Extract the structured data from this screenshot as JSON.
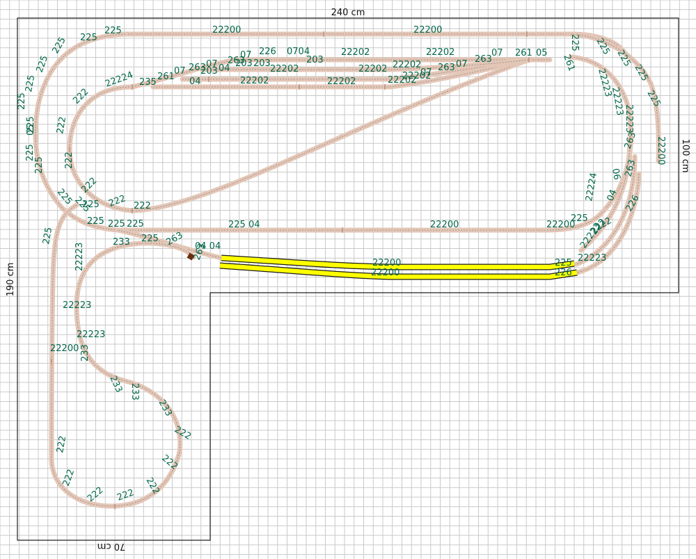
{
  "dimensions": {
    "width_top": "240 cm",
    "height_left": "190 cm",
    "height_right": "100 cm",
    "width_bottom": "70 cm"
  },
  "colors": {
    "track_bed": "#e4c6b6",
    "label": "#00674a",
    "selected_track": "#ffff00",
    "grid": "#c9c9c9"
  },
  "labels": [
    {
      "t": "225",
      "a": 0
    },
    {
      "t": "225",
      "a": 0
    },
    {
      "t": "22200",
      "a": 0
    },
    {
      "t": "22200",
      "a": 0
    },
    {
      "t": "225",
      "a": 0
    },
    {
      "t": "225",
      "a": 0
    },
    {
      "t": "225",
      "a": 0
    },
    {
      "t": "225",
      "a": 0
    },
    {
      "t": "225",
      "a": 0
    },
    {
      "t": "225",
      "a": 0
    },
    {
      "t": "22200",
      "a": 0
    },
    {
      "t": "225",
      "a": 0
    },
    {
      "t": "225",
      "a": 0
    },
    {
      "t": "225",
      "a": 0
    },
    {
      "t": "225",
      "a": 0
    },
    {
      "t": "225",
      "a": 0
    },
    {
      "t": "05",
      "a": -90
    },
    {
      "t": "225",
      "a": -90
    },
    {
      "t": "225",
      "a": 0
    },
    {
      "t": "225",
      "a": 0
    },
    {
      "t": "225",
      "a": 0
    },
    {
      "t": "225",
      "a": 0
    },
    {
      "t": "225",
      "a": 0
    },
    {
      "t": "225 04",
      "a": 0
    },
    {
      "t": "22200",
      "a": 0
    },
    {
      "t": "22200",
      "a": 0
    },
    {
      "t": "225",
      "a": 0
    },
    {
      "t": "22224",
      "a": 0
    },
    {
      "t": "222",
      "a": 0
    },
    {
      "t": "222",
      "a": 0
    },
    {
      "t": "222",
      "a": 0
    },
    {
      "t": "222",
      "a": 0
    },
    {
      "t": "222",
      "a": 0
    },
    {
      "t": "222",
      "a": 0
    },
    {
      "t": "235",
      "a": 0
    },
    {
      "t": "261",
      "a": 0
    },
    {
      "t": "07",
      "a": 0
    },
    {
      "t": "263",
      "a": 0
    },
    {
      "t": "07",
      "a": 0
    },
    {
      "t": "263",
      "a": 0
    },
    {
      "t": "07",
      "a": 0
    },
    {
      "t": "226",
      "a": 0
    },
    {
      "t": "0704",
      "a": 0
    },
    {
      "t": "203",
      "a": 0
    },
    {
      "t": "04",
      "a": 0
    },
    {
      "t": "203",
      "a": 0
    },
    {
      "t": "203",
      "a": 0
    },
    {
      "t": "04",
      "a": 0
    },
    {
      "t": "203",
      "a": 0
    },
    {
      "t": "22202",
      "a": 0
    },
    {
      "t": "22202",
      "a": 0
    },
    {
      "t": "22202",
      "a": 0
    },
    {
      "t": "22202",
      "a": 0
    },
    {
      "t": "22202",
      "a": 0
    },
    {
      "t": "22202",
      "a": 0
    },
    {
      "t": "22202",
      "a": 0
    },
    {
      "t": "22202",
      "a": 0
    },
    {
      "t": "22202",
      "a": 0
    },
    {
      "t": "07",
      "a": 0
    },
    {
      "t": "263",
      "a": 0
    },
    {
      "t": "07",
      "a": 0
    },
    {
      "t": "263",
      "a": 0
    },
    {
      "t": "07",
      "a": 0
    },
    {
      "t": "261",
      "a": 0
    },
    {
      "t": "05",
      "a": 0
    },
    {
      "t": "261",
      "a": 0
    },
    {
      "t": "22223",
      "a": 0
    },
    {
      "t": "22223",
      "a": 0
    },
    {
      "t": "22223",
      "a": 0
    },
    {
      "t": "263",
      "a": 0
    },
    {
      "t": "22224",
      "a": 0
    },
    {
      "t": "06",
      "a": 0
    },
    {
      "t": "263",
      "a": 0
    },
    {
      "t": "04",
      "a": 0
    },
    {
      "t": "226",
      "a": 0
    },
    {
      "t": "222",
      "a": 0
    },
    {
      "t": "22223",
      "a": 0
    },
    {
      "t": "222",
      "a": 0
    },
    {
      "t": "22223",
      "a": 0
    },
    {
      "t": "22200",
      "a": 0
    },
    {
      "t": "22200",
      "a": 0
    },
    {
      "t": "225",
      "a": 0
    },
    {
      "t": "226",
      "a": 0
    },
    {
      "t": "225",
      "a": 0
    },
    {
      "t": "233",
      "a": 0
    },
    {
      "t": "225",
      "a": 0
    },
    {
      "t": "263",
      "a": 0
    },
    {
      "t": "04 04",
      "a": 0
    },
    {
      "t": "22223",
      "a": 0
    },
    {
      "t": "263",
      "a": 0
    },
    {
      "t": "225",
      "a": 0
    },
    {
      "t": "22223",
      "a": 0
    },
    {
      "t": "22223",
      "a": 0
    },
    {
      "t": "22200",
      "a": 0
    },
    {
      "t": "233",
      "a": 0
    },
    {
      "t": "233",
      "a": 0
    },
    {
      "t": "233",
      "a": 0
    },
    {
      "t": "233",
      "a": 0
    },
    {
      "t": "222",
      "a": 0
    },
    {
      "t": "222",
      "a": 0
    },
    {
      "t": "222",
      "a": 0
    },
    {
      "t": "222",
      "a": 0
    },
    {
      "t": "222",
      "a": 0
    },
    {
      "t": "222",
      "a": 0
    },
    {
      "t": "222",
      "a": 0
    }
  ]
}
